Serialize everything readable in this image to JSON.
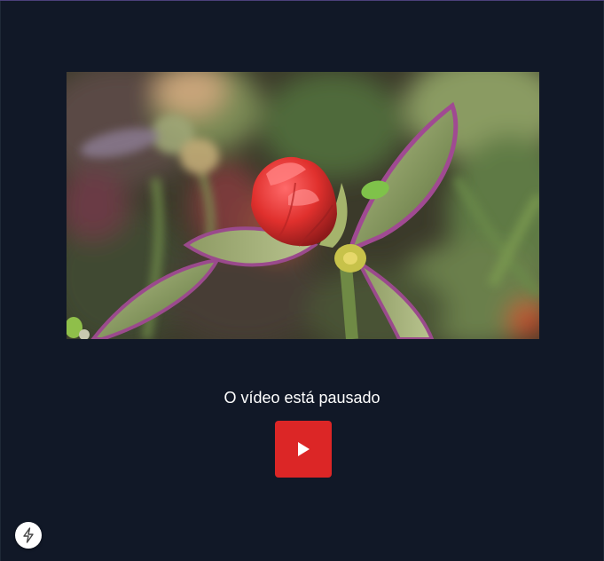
{
  "player": {
    "status_text": "O vídeo está pausado",
    "play_button_icon": "play-icon",
    "accent_color": "#dc2626",
    "background_color": "#111827"
  },
  "video": {
    "thumbnail": "flower-bud-image"
  },
  "corner_badge": {
    "icon": "lightning-icon"
  }
}
